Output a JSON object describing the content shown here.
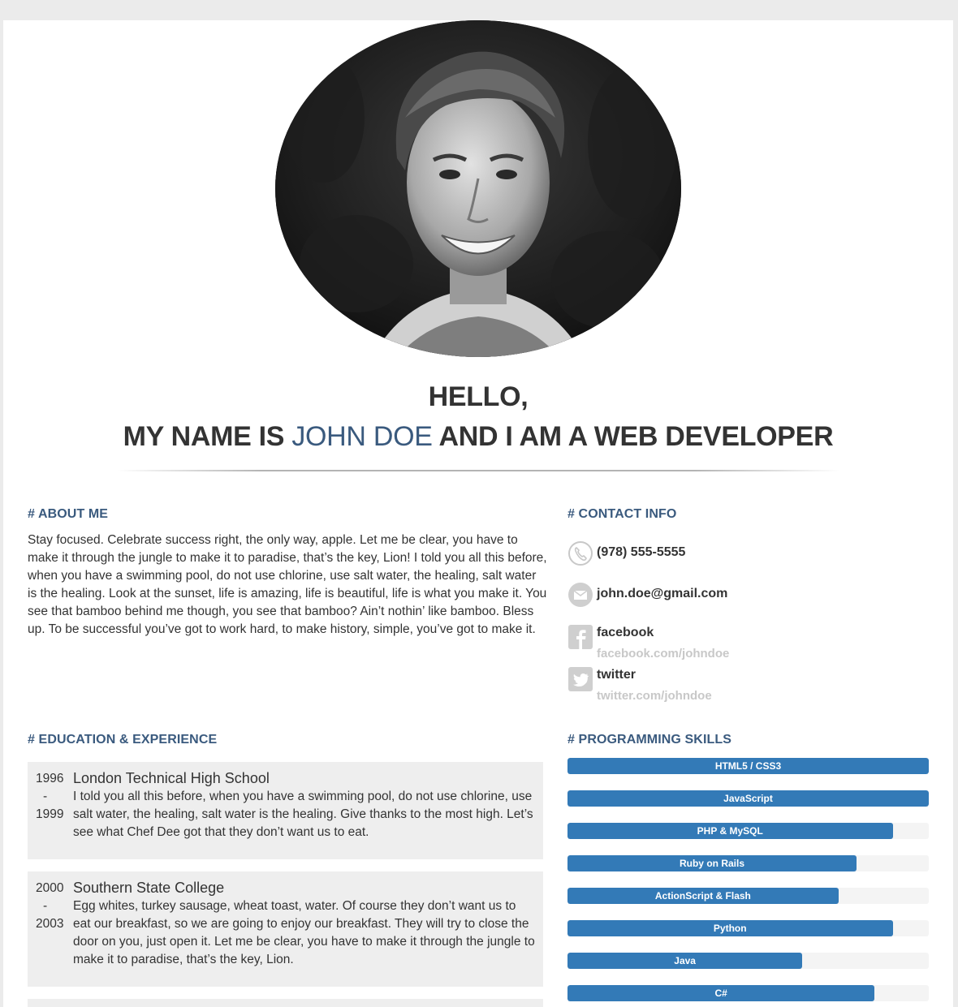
{
  "header": {
    "greeting": "HELLO,",
    "intro_prefix": "MY NAME IS",
    "name": "JOHN DOE",
    "intro_suffix": "AND I AM A WEB DEVELOPER"
  },
  "about": {
    "title": "# ABOUT ME",
    "text": "Stay focused. Celebrate success right, the only way, apple. Let me be clear, you have to make it through the jungle to make it to paradise, that’s the key, Lion! I told you all this before, when you have a swimming pool, do not use chlorine, use salt water, the healing, salt water is the healing. Look at the sunset, life is amazing, life is beautiful, life is what you make it. You see that bamboo behind me though, you see that bamboo? Ain’t nothin’ like bamboo. Bless up. To be successful you’ve got to work hard, to make history, simple, you’ve got to make it."
  },
  "contact": {
    "title": "# CONTACT INFO",
    "phone": "(978) 555-5555",
    "email": "john.doe@gmail.com",
    "facebook_label": "facebook",
    "facebook_url": "facebook.com/johndoe",
    "twitter_label": "twitter",
    "twitter_url": "twitter.com/johndoe",
    "icons": [
      "phone-icon",
      "mail-icon",
      "facebook-icon",
      "twitter-icon"
    ]
  },
  "education": {
    "title": "# EDUCATION & EXPERIENCE",
    "items": [
      {
        "year_start": "1996",
        "separator": "-",
        "year_end": "1999",
        "name": "London Technical High School",
        "description": "I told you all this before, when you have a swimming pool, do not use chlorine, use salt water, the healing, salt water is the healing. Give thanks to the most high. Let’s see what Chef Dee got that they don’t want us to eat."
      },
      {
        "year_start": "2000",
        "separator": "-",
        "year_end": "2003",
        "name": "Southern State College",
        "description": "Egg whites, turkey sausage, wheat toast, water. Of course they don’t want us to eat our breakfast, so we are going to enjoy our breakfast. They will try to close the door on you, just open it. Let me be clear, you have to make it through the jungle to make it to paradise, that’s the key, Lion."
      }
    ]
  },
  "skills": {
    "title": "# PROGRAMMING SKILLS",
    "items": [
      {
        "name": "HTML5 / CSS3",
        "level": 100
      },
      {
        "name": "JavaScript",
        "level": 100
      },
      {
        "name": "PHP & MySQL",
        "level": 90
      },
      {
        "name": "Ruby on Rails",
        "level": 80
      },
      {
        "name": "ActionScript & Flash",
        "level": 75
      },
      {
        "name": "Python",
        "level": 90
      },
      {
        "name": "Java",
        "level": 65
      },
      {
        "name": "C#",
        "level": 85
      }
    ]
  },
  "colors": {
    "accent": "#3a5a7e",
    "bar": "#337ab7",
    "card": "#eeeeee"
  }
}
